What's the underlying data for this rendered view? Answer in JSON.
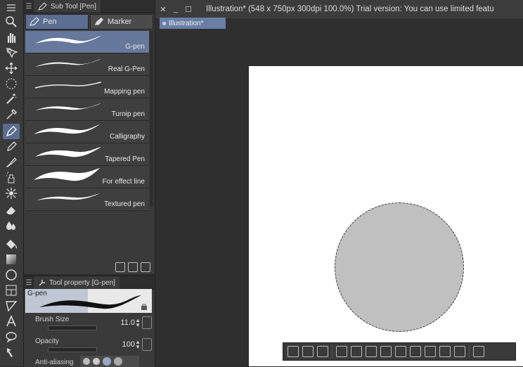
{
  "subtool_panel": {
    "header_title": "Sub Tool [Pen]",
    "group_tabs": [
      {
        "label": "Pen",
        "active": true
      },
      {
        "label": "Marker",
        "active": false
      }
    ],
    "brushes": [
      {
        "label": "G-pen",
        "selected": true
      },
      {
        "label": "Real G-Pen",
        "selected": false
      },
      {
        "label": "Mapping pen",
        "selected": false
      },
      {
        "label": "Turnip pen",
        "selected": false
      },
      {
        "label": "Calligraphy",
        "selected": false
      },
      {
        "label": "Tapered Pen",
        "selected": false
      },
      {
        "label": "For effect line",
        "selected": false
      },
      {
        "label": "Textured pen",
        "selected": false
      }
    ]
  },
  "tool_property": {
    "header_title": "Tool property [G-pen]",
    "preview_name": "G-pen",
    "brush_size": {
      "label": "Brush Size",
      "value": "11.0"
    },
    "opacity": {
      "label": "Opacity",
      "value": "100"
    },
    "anti_aliasing": {
      "label": "Anti-aliasing"
    }
  },
  "canvas": {
    "title": "Illustration* (548 x 750px 300dpi 100.0%)  Trial version: You can use limited featu",
    "doc_tab": "Illustration*"
  },
  "colors": {
    "accent": "#5c6e92",
    "panel": "#3a3a3a",
    "selection_fill": "#c0c0c0"
  }
}
